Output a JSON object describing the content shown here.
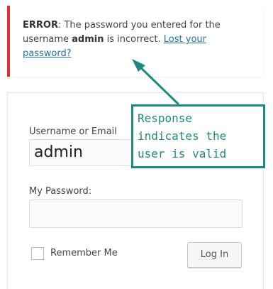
{
  "error": {
    "prefix": "ERROR",
    "text_1": ": The password you entered for the username ",
    "username": "admin",
    "text_2": " is incorrect. ",
    "link": "Lost your password?"
  },
  "form": {
    "username_label": "Username or Email",
    "username_value": "admin",
    "password_label": "My Password:",
    "password_value": "",
    "remember_label": "Remember Me",
    "login_button": "Log In"
  },
  "annotation": {
    "text": "Response\nindicates the\nuser is valid",
    "color": "#1f8a80"
  },
  "colors": {
    "error_border": "#dc3232",
    "link": "#2271b1"
  }
}
